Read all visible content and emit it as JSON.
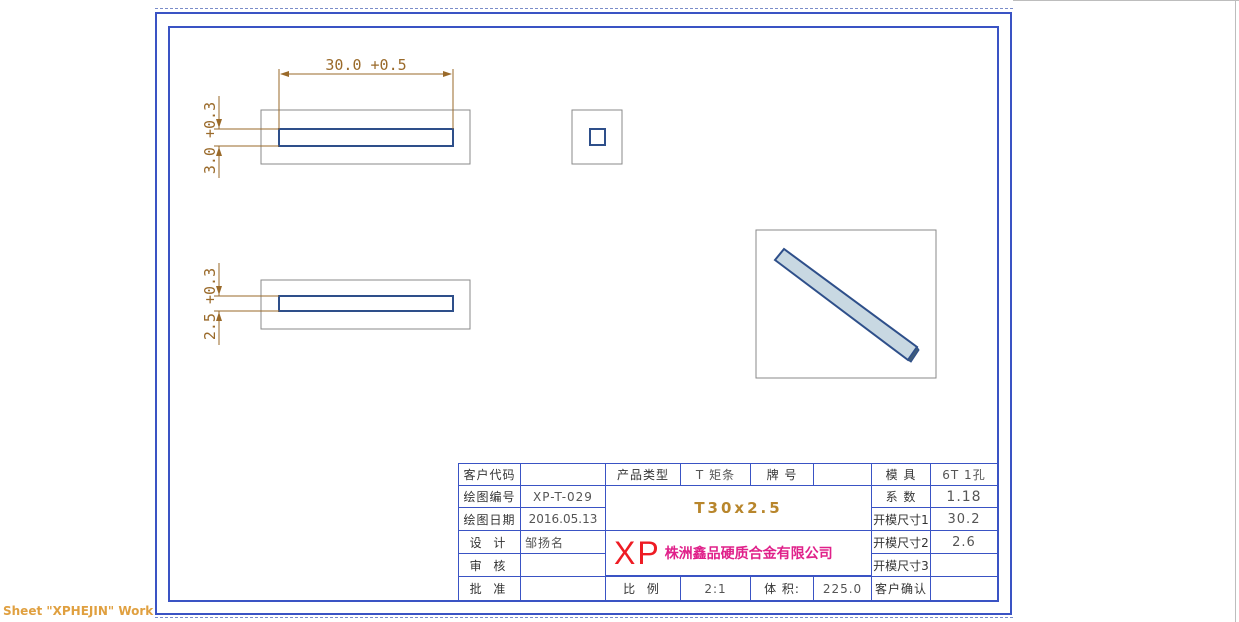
{
  "window": {
    "sheet_tab": "Sheet \"XPHEJIN\" Work"
  },
  "drawing": {
    "dim_length": "30.0 +0.5",
    "dim_width_top": "3.0 +0.3",
    "dim_width_bottom": "2.5 +0.3"
  },
  "title_block": {
    "customer_code_label": "客户代码",
    "customer_code_value": "",
    "product_type_label": "产品类型",
    "product_type_value": "T 矩条",
    "grade_label": "牌 号",
    "grade_value": "",
    "mold_label": "模 具",
    "mold_value": "6T 1孔",
    "drawing_no_label": "绘图编号",
    "drawing_no_value": "XP-T-029",
    "spec_value": "T30x2.5",
    "coef_label": "系 数",
    "coef_value": "1.18",
    "date_label": "绘图日期",
    "date_value": "2016.05.13",
    "mold_size1_label": "开模尺寸1",
    "mold_size1_value": "30.2",
    "design_label": "设 计",
    "design_value": "邹扬名",
    "mold_size2_label": "开模尺寸2",
    "mold_size2_value": "2.6",
    "review_label": "审 核",
    "review_value": "",
    "mold_size3_label": "开模尺寸3",
    "mold_size3_value": "",
    "approve_label": "批 准",
    "approve_value": "",
    "scale_label": "比 例",
    "scale_value": "2:1",
    "volume_label": "体 积:",
    "volume_value": "225.0",
    "customer_confirm_label": "客户确认",
    "customer_confirm_value": "",
    "logo_letters": "XP",
    "company_name": "株洲鑫品硬质合金有限公司"
  }
}
